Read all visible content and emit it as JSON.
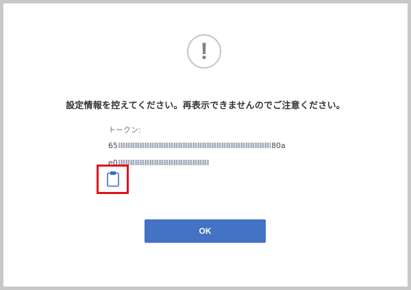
{
  "dialog": {
    "icon": "exclamation-icon",
    "icon_glyph": "!",
    "message": "設定情報を控えてください。再表示できませんのでご注意ください。",
    "token_label": "トークン:",
    "token_line1_prefix": "65",
    "token_line1_suffix": "80a",
    "token_line2_prefix": "e0",
    "copy_icon": "clipboard-icon",
    "ok_label": "OK"
  },
  "colors": {
    "button": "#4472c4",
    "highlight": "#e0101a",
    "icon_border": "#c9c2bc"
  }
}
